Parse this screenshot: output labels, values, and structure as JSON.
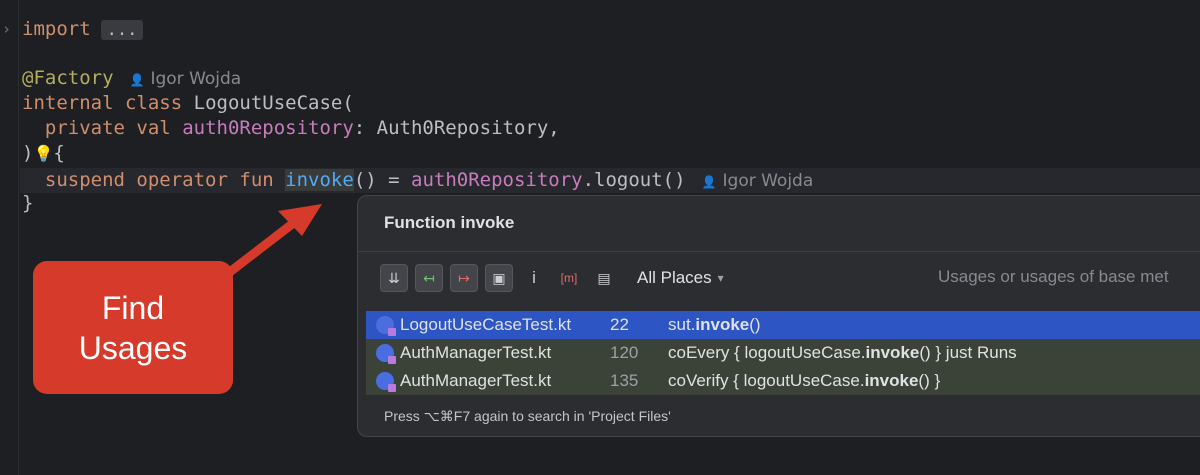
{
  "editor": {
    "fold_chevron": "›",
    "import_kw": "import",
    "import_fold": "...",
    "annotation": "@Factory",
    "author_hint": "Igor Wojda",
    "line_class": {
      "kw1": "internal",
      "kw2": "class",
      "name": "LogoutUseCase("
    },
    "line_param": {
      "kw1": "private",
      "kw2": "val",
      "prop": "auth0Repository",
      "rest": ": Auth0Repository,"
    },
    "line_close": ")",
    "line_open": "{",
    "line_fun": {
      "kw1": "suspend",
      "kw2": "operator",
      "kw3": "fun",
      "name": "invoke",
      "rest1": "() = ",
      "prop": "auth0Repository",
      "rest2": ".logout()"
    },
    "line_end": "}"
  },
  "callout": {
    "line1": "Find",
    "line2": "Usages"
  },
  "popup": {
    "title": "Function invoke",
    "toolbar": [
      {
        "icon": "merge-usages-icon",
        "glyph": "⇊",
        "on": true
      },
      {
        "icon": "read-access-icon",
        "glyph": "↤",
        "on": true
      },
      {
        "icon": "write-access-icon",
        "glyph": "↦",
        "on": true
      },
      {
        "icon": "module-folder-icon",
        "glyph": "▣",
        "on": true
      },
      {
        "icon": "import-icon",
        "glyph": "i",
        "on": false
      },
      {
        "icon": "method-icon",
        "glyph": "[m]",
        "on": false
      },
      {
        "icon": "preview-icon",
        "glyph": "▤",
        "on": false
      }
    ],
    "scope": "All Places",
    "description": "Usages or usages of base met",
    "rows": [
      {
        "file": "LogoutUseCaseTest.kt",
        "line": "22",
        "pre": "sut.",
        "hit": "invoke",
        "post": "()"
      },
      {
        "file": "AuthManagerTest.kt",
        "line": "120",
        "pre": "coEvery { logoutUseCase.",
        "hit": "invoke",
        "post": "() } just Runs"
      },
      {
        "file": "AuthManagerTest.kt",
        "line": "135",
        "pre": "coVerify { logoutUseCase.",
        "hit": "invoke",
        "post": "() }"
      }
    ],
    "footer": "Press ⌥⌘F7 again to search in 'Project Files'"
  },
  "colors": {
    "callout": "#d63a2a",
    "selection": "#2e55c4",
    "usage_row": "#3b4238"
  }
}
